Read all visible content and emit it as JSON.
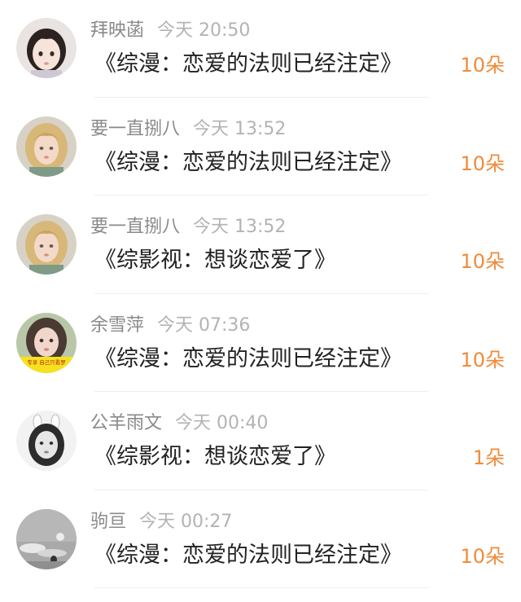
{
  "gift_list": {
    "items": [
      {
        "name": "拜映菡",
        "time": "今天 20:50",
        "title": "《综漫：恋爱的法则已经注定》",
        "count": "10朵",
        "avatar_icon": "avatar-toddler-girl-icon"
      },
      {
        "name": "要一直捌八",
        "time": "今天 13:52",
        "title": "《综漫：恋爱的法则已经注定》",
        "count": "10朵",
        "avatar_icon": "avatar-blonde-girl-icon"
      },
      {
        "name": "要一直捌八",
        "time": "今天 13:52",
        "title": "《综影视：想谈恋爱了》",
        "count": "10朵",
        "avatar_icon": "avatar-blonde-girl-icon"
      },
      {
        "name": "余雪萍",
        "time": "今天 07:36",
        "title": "《综漫：恋爱的法则已经注定》",
        "count": "10朵",
        "avatar_icon": "avatar-girl-banner-icon"
      },
      {
        "name": "公羊雨文",
        "time": "今天 00:40",
        "title": "《综影视：想谈恋爱了》",
        "count": "1朵",
        "avatar_icon": "avatar-bw-girl-icon"
      },
      {
        "name": "驹亘",
        "time": "今天 00:27",
        "title": "《综漫：恋爱的法则已经注定》",
        "count": "10朵",
        "avatar_icon": "avatar-gray-landscape-icon"
      }
    ]
  },
  "colors": {
    "name": "#8a8a8a",
    "time": "#b3b3b3",
    "title": "#222222",
    "count": "#f08b3a",
    "divider": "#eeeeee"
  },
  "avatar_caption": "专享 自己只看罗"
}
